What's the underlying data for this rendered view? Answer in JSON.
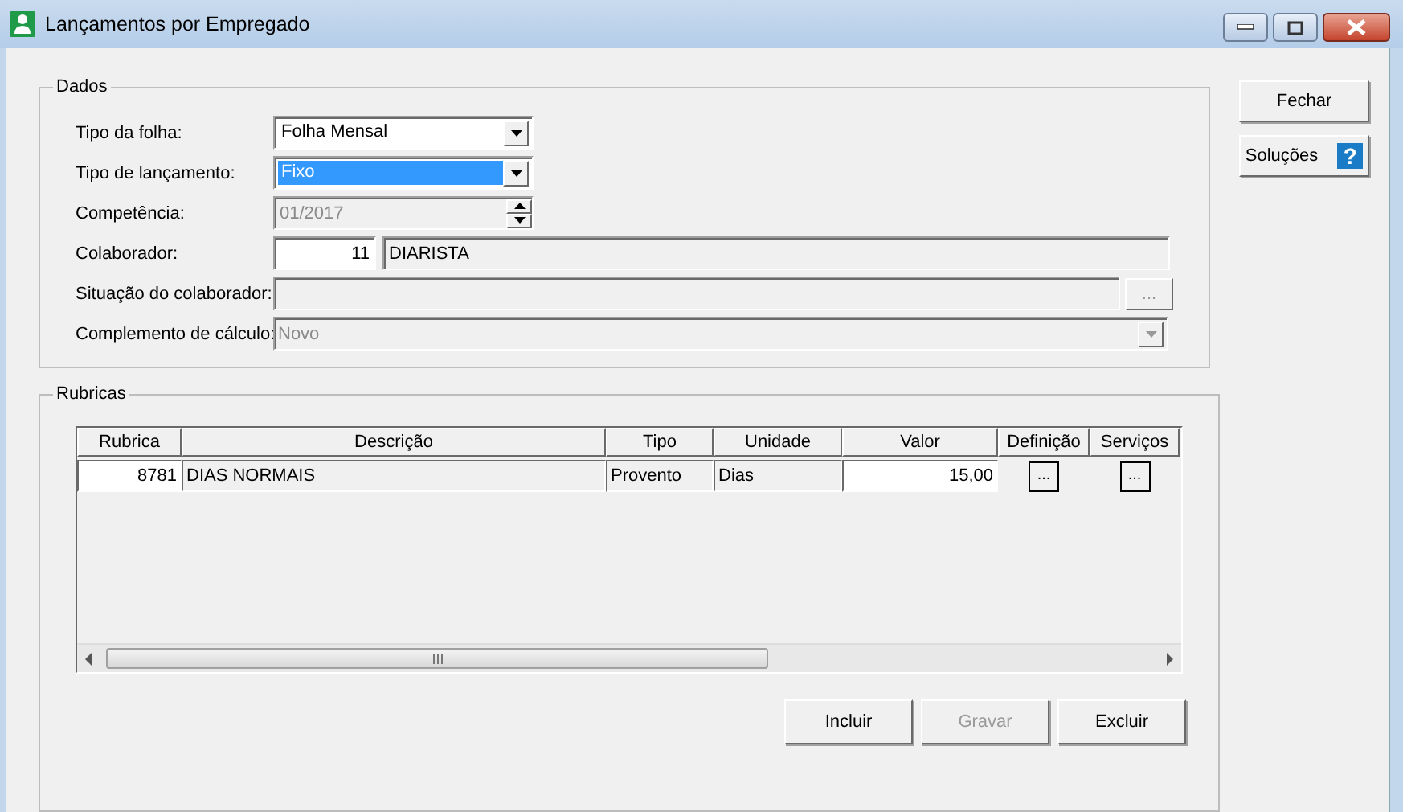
{
  "window": {
    "title": "Lançamentos por Empregado"
  },
  "dados": {
    "title": "Dados",
    "fields": [
      {
        "kind": "combo",
        "label": "Tipo da folha:",
        "value": "Folha Mensal",
        "selected": false,
        "disabled": false
      },
      {
        "kind": "combo",
        "label": "Tipo de lançamento:",
        "value": "Fixo",
        "selected": true,
        "disabled": false
      },
      {
        "kind": "spin",
        "label": "Competência:",
        "value": "01/2017",
        "disabled": true
      },
      {
        "kind": "code_name",
        "label": "Colaborador:",
        "code": "11",
        "name": "DIARISTA"
      },
      {
        "kind": "lookup",
        "label": "Situação do colaborador:",
        "button": "...",
        "disabled": true
      },
      {
        "kind": "combo_wide",
        "label": "Complemento de cálculo:",
        "value": "Novo",
        "disabled": true
      }
    ]
  },
  "side_buttons": [
    {
      "kind": "plain",
      "label": "Fechar"
    },
    {
      "kind": "help",
      "label": "Soluções",
      "icon": "?"
    }
  ],
  "rubricas": {
    "title": "Rubricas",
    "columns": [
      "Rubrica",
      "Descrição",
      "Tipo",
      "Unidade",
      "Valor",
      "Definição",
      "Serviços"
    ],
    "rows": [
      {
        "rubrica": "8781",
        "descricao": "DIAS NORMAIS",
        "tipo": "Provento",
        "unidade": "Dias",
        "valor": "15,00",
        "definicao": "...",
        "servicos": "..."
      }
    ],
    "actions": [
      {
        "label": "Incluir",
        "disabled": false
      },
      {
        "label": "Gravar",
        "disabled": true
      },
      {
        "label": "Excluir",
        "disabled": false
      }
    ]
  }
}
